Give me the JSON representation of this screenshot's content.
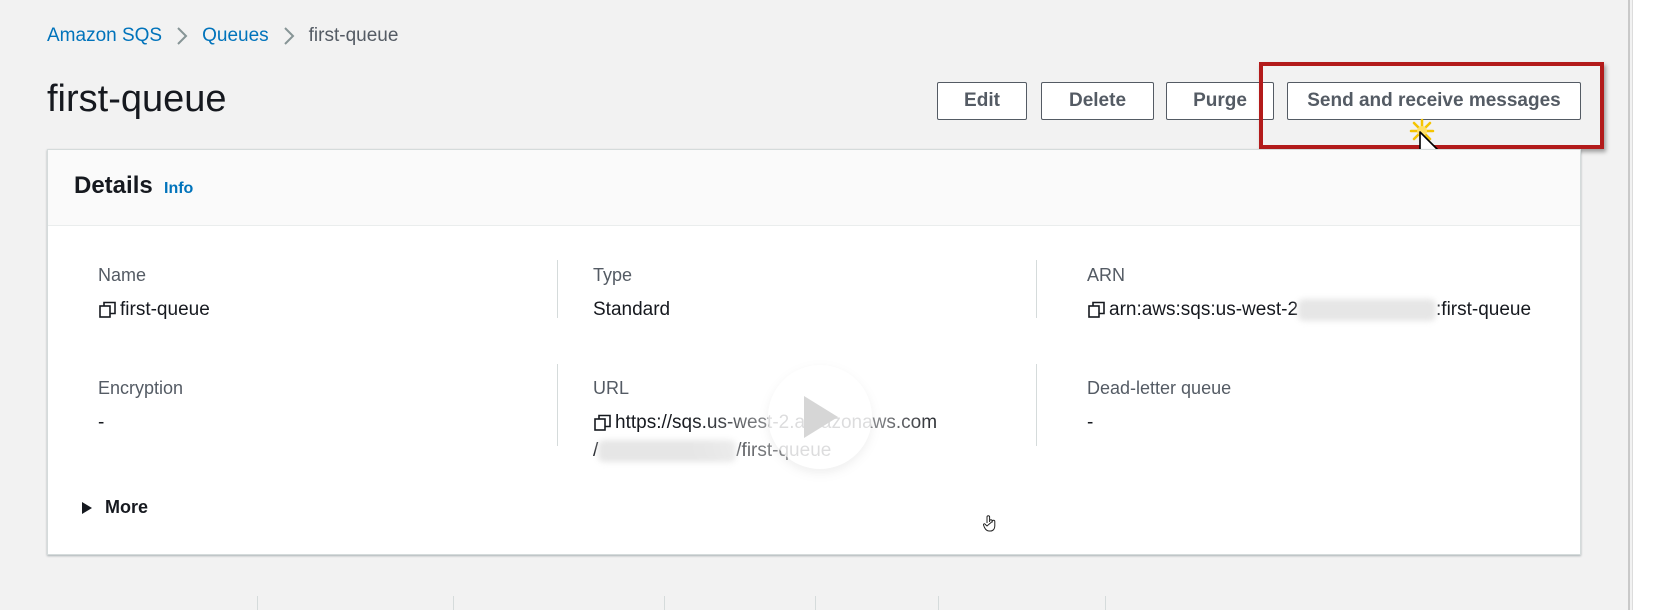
{
  "breadcrumb": {
    "root": "Amazon SQS",
    "section": "Queues",
    "current": "first-queue"
  },
  "page": {
    "title": "first-queue"
  },
  "actions": {
    "edit": "Edit",
    "delete": "Delete",
    "purge": "Purge",
    "send_receive": "Send and receive messages"
  },
  "details": {
    "title": "Details",
    "info": "Info",
    "name_label": "Name",
    "name_value": "first-queue",
    "type_label": "Type",
    "type_value": "Standard",
    "arn_label": "ARN",
    "arn_prefix": "arn:aws:sqs:us-west-2",
    "arn_suffix": ":first-queue",
    "encryption_label": "Encryption",
    "encryption_value": "-",
    "url_label": "URL",
    "url_line1": "https://sqs.us-west-2.amazonaws.com",
    "url_line2_prefix": "/",
    "url_line2_suffix": "/first-queue",
    "dlq_label": "Dead-letter queue",
    "dlq_value": "-",
    "more": "More"
  },
  "icons": {
    "copy": "copy-icon",
    "chevron": "chevron-right-icon",
    "caret": "caret-right-icon",
    "play": "play-icon",
    "cursor": "pointer-cursor-icon",
    "hand": "hand-cursor-icon"
  },
  "colors": {
    "link": "#0073bb",
    "highlight": "#b31b1b",
    "button_text": "#545b64"
  }
}
